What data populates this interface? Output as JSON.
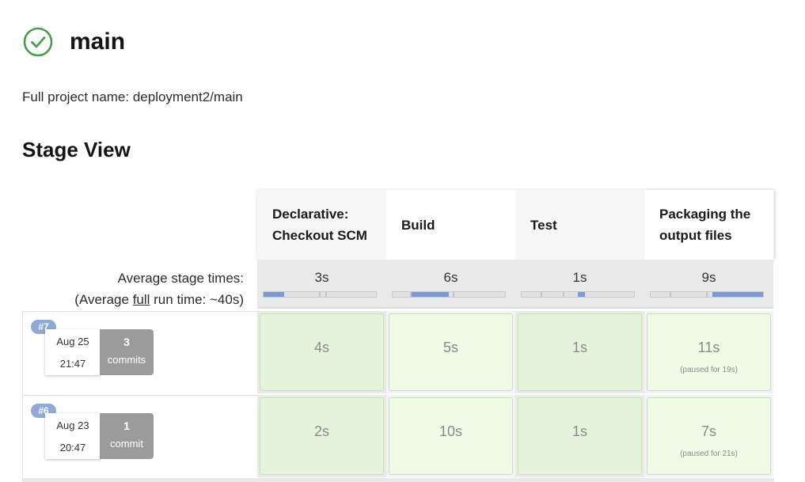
{
  "job": {
    "title": "main",
    "status_icon": "check-circle-icon",
    "status_color": "#4a9d4a"
  },
  "full_name": "Full project name: deployment2/main",
  "stage_view_title": "Stage View",
  "stages": [
    {
      "name": "Declarative: Checkout SCM",
      "avg": "3s",
      "avg_fraction": 0.18,
      "avg_offset": 0.0
    },
    {
      "name": "Build",
      "avg": "6s",
      "avg_fraction": 0.33,
      "avg_offset": 0.17
    },
    {
      "name": "Test",
      "avg": "1s",
      "avg_fraction": 0.06,
      "avg_offset": 0.5
    },
    {
      "name": "Packaging the output files",
      "avg": "9s",
      "avg_fraction": 0.45,
      "avg_offset": 0.55
    }
  ],
  "average": {
    "label": "Average stage times:",
    "full_run_prefix": "(Average ",
    "full_run_link": "full",
    "full_run_suffix": " run time: ~40s)"
  },
  "runs": [
    {
      "id": "#7",
      "date": "Aug 25",
      "time": "21:47",
      "commit_count": "3",
      "commit_label": "commits",
      "stages": [
        {
          "time": "4s",
          "note": ""
        },
        {
          "time": "5s",
          "note": ""
        },
        {
          "time": "1s",
          "note": ""
        },
        {
          "time": "11s",
          "note": "(paused for 19s)"
        }
      ]
    },
    {
      "id": "#6",
      "date": "Aug 23",
      "time": "20:47",
      "commit_count": "1",
      "commit_label": "commit",
      "stages": [
        {
          "time": "2s",
          "note": ""
        },
        {
          "time": "10s",
          "note": ""
        },
        {
          "time": "1s",
          "note": ""
        },
        {
          "time": "7s",
          "note": "(paused for 21s)"
        }
      ]
    }
  ],
  "colors": {
    "progress_fill": "#7a9ad6",
    "success_cell": "#e6f3dc",
    "badge": "#8fa9d8",
    "commit_box": "#9b9b9b"
  }
}
